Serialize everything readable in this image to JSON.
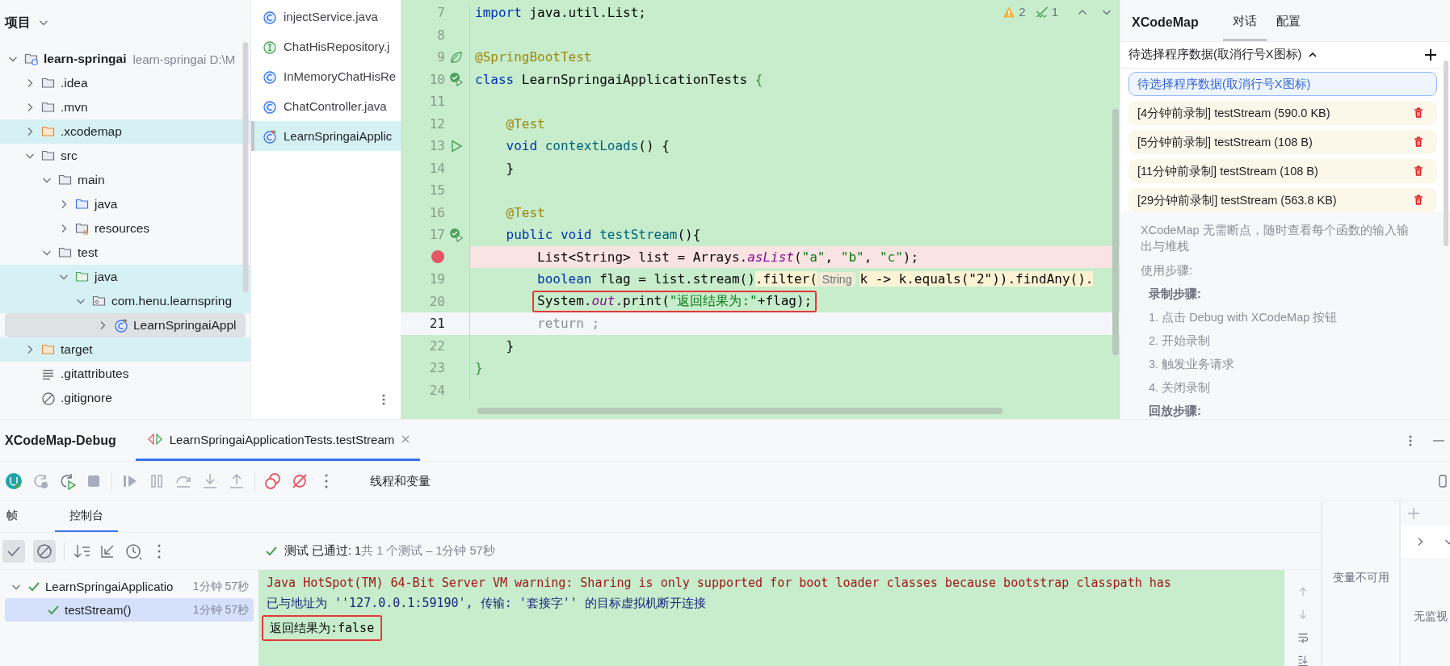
{
  "project": {
    "title": "项目",
    "tree": [
      {
        "name": "learn-springai",
        "detail": "learn-springai  D:\\M",
        "kind": "module",
        "expanded": true,
        "highlighted": false,
        "selected": false,
        "children": [
          {
            "name": ".idea",
            "kind": "folder",
            "expanded": false,
            "highlighted": false,
            "selected": false
          },
          {
            "name": ".mvn",
            "kind": "folder",
            "expanded": false,
            "highlighted": false,
            "selected": false
          },
          {
            "name": ".xcodemap",
            "kind": "excluded",
            "expanded": false,
            "highlighted": true,
            "selected": false
          },
          {
            "name": "src",
            "kind": "folder",
            "expanded": true,
            "highlighted": false,
            "selected": false,
            "children": [
              {
                "name": "main",
                "kind": "folder",
                "expanded": true,
                "highlighted": false,
                "selected": false,
                "children": [
                  {
                    "name": "java",
                    "kind": "source",
                    "expanded": false,
                    "highlighted": false,
                    "selected": false
                  },
                  {
                    "name": "resources",
                    "kind": "resources",
                    "expanded": false,
                    "highlighted": false,
                    "selected": false
                  }
                ]
              },
              {
                "name": "test",
                "kind": "folder",
                "expanded": true,
                "highlighted": false,
                "selected": false,
                "children": [
                  {
                    "name": "java",
                    "kind": "test-source",
                    "expanded": true,
                    "highlighted": true,
                    "selected": false,
                    "children": [
                      {
                        "name": "com.henu.learnspring",
                        "kind": "package",
                        "expanded": true,
                        "highlighted": true,
                        "selected": false,
                        "children": [
                          {
                            "name": "LearnSpringaiAppl",
                            "kind": "test-class",
                            "expanded": false,
                            "highlighted": false,
                            "selected": true
                          }
                        ]
                      }
                    ]
                  }
                ]
              }
            ]
          },
          {
            "name": "target",
            "kind": "excluded",
            "expanded": false,
            "highlighted": true,
            "selected": false
          },
          {
            "name": ".gitattributes",
            "kind": "text",
            "highlighted": false,
            "selected": false
          },
          {
            "name": ".gitignore",
            "kind": "ignore",
            "highlighted": false,
            "selected": false
          }
        ]
      }
    ]
  },
  "files": [
    {
      "name": "injectService.java",
      "kind": "class",
      "selected": false
    },
    {
      "name": "ChatHisRepository.j",
      "kind": "interface",
      "selected": false
    },
    {
      "name": "InMemoryChatHisRe",
      "kind": "class",
      "selected": false
    },
    {
      "name": "ChatController.java",
      "kind": "class",
      "selected": false
    },
    {
      "name": "LearnSpringaiApplic",
      "kind": "test-class",
      "selected": true
    }
  ],
  "editor": {
    "inspections": {
      "warnings": "2",
      "typos": "1"
    },
    "lines": [
      {
        "number": "7",
        "kind": "plain",
        "current": false,
        "boxed": false,
        "segments": [
          {
            "kind": "keyword",
            "text": "import"
          },
          {
            "kind": "plain",
            "text": " java.util.List;"
          }
        ]
      },
      {
        "number": "8",
        "kind": "plain",
        "current": false,
        "boxed": false
      },
      {
        "number": "9",
        "kind": "spring",
        "current": false,
        "boxed": false,
        "segments": [
          {
            "kind": "annotation",
            "text": "@SpringBootTest"
          }
        ]
      },
      {
        "number": "10",
        "kind": "run-test",
        "current": false,
        "boxed": false,
        "segments": [
          {
            "kind": "keyword",
            "text": "class"
          },
          {
            "kind": "plain",
            "text": " LearnSpringaiApplicationTests "
          },
          {
            "kind": "brace",
            "text": "{"
          }
        ]
      },
      {
        "number": "11",
        "kind": "plain",
        "current": false,
        "boxed": false
      },
      {
        "number": "12",
        "kind": "plain",
        "current": false,
        "boxed": false,
        "segments": [
          {
            "kind": "annotation",
            "text": "    @Test"
          }
        ]
      },
      {
        "number": "13",
        "kind": "run",
        "current": false,
        "boxed": false,
        "segments": [
          {
            "kind": "keyword",
            "text": "    void"
          },
          {
            "kind": "method",
            "text": " contextLoads"
          },
          {
            "kind": "plain",
            "text": "() {"
          }
        ]
      },
      {
        "number": "14",
        "kind": "plain",
        "current": false,
        "boxed": false,
        "segments": [
          {
            "kind": "plain",
            "text": "    }"
          }
        ]
      },
      {
        "number": "15",
        "kind": "plain",
        "current": false,
        "boxed": false
      },
      {
        "number": "16",
        "kind": "plain",
        "current": false,
        "boxed": false,
        "segments": [
          {
            "kind": "annotation",
            "text": "    @Test"
          }
        ]
      },
      {
        "number": "17",
        "kind": "run-test",
        "current": false,
        "boxed": false,
        "segments": [
          {
            "kind": "keyword",
            "text": "    public void"
          },
          {
            "kind": "method",
            "text": " testStream"
          },
          {
            "kind": "plain",
            "text": "(){"
          }
        ]
      },
      {
        "kind": "breakpoint",
        "current": false,
        "boxed": false,
        "segments": [
          {
            "kind": "plain",
            "text": "        List<String> list = Arrays."
          },
          {
            "kind": "static",
            "text": "asList"
          },
          {
            "kind": "plain",
            "text": "("
          },
          {
            "kind": "string",
            "text": "\"a\""
          },
          {
            "kind": "plain",
            "text": ", "
          },
          {
            "kind": "string",
            "text": "\"b\""
          },
          {
            "kind": "plain",
            "text": ", "
          },
          {
            "kind": "string",
            "text": "\"c\""
          },
          {
            "kind": "plain",
            "text": ");"
          }
        ]
      },
      {
        "number": "19",
        "kind": "plain",
        "current": false,
        "boxed": false,
        "segments": [
          {
            "kind": "keyword",
            "text": "        boolean"
          },
          {
            "kind": "plain",
            "text": " flag = list.stream()"
          },
          {
            "kind": "chain",
            "text": ".filter("
          },
          {
            "kind": "hint",
            "text": "String"
          },
          {
            "kind": "chain",
            "text": "k -> k.equals(\"2\")).findAny()."
          }
        ]
      },
      {
        "number": "20",
        "kind": "plain",
        "current": false,
        "boxed": true,
        "segments": [
          {
            "kind": "plain",
            "text": "        System."
          },
          {
            "kind": "static",
            "text": "out"
          },
          {
            "kind": "plain",
            "text": ".print("
          },
          {
            "kind": "string",
            "text": "\"返回结果为:\""
          },
          {
            "kind": "plain",
            "text": "+flag);"
          }
        ]
      },
      {
        "number": "21",
        "kind": "plain",
        "current": true,
        "boxed": false,
        "segments": [
          {
            "kind": "dim",
            "text": "        return ;"
          }
        ]
      },
      {
        "number": "22",
        "kind": "plain",
        "current": false,
        "boxed": false,
        "segments": [
          {
            "kind": "plain",
            "text": "    }"
          }
        ]
      },
      {
        "number": "23",
        "kind": "plain",
        "current": false,
        "boxed": false,
        "segments": [
          {
            "kind": "brace",
            "text": "}"
          }
        ]
      },
      {
        "number": "24",
        "kind": "plain",
        "current": false,
        "boxed": false
      }
    ]
  },
  "xcodemap": {
    "title": "XCodeMap",
    "tabs": [
      {
        "label": "对话",
        "selected": true
      },
      {
        "label": "配置",
        "selected": false
      }
    ],
    "picker": "待选择程序数据(取消行号X图标)",
    "records": [
      {
        "kind": "placeholder",
        "text": "待选择程序数据(取消行号X图标)",
        "selected": true
      },
      {
        "kind": "recording",
        "text": "[4分钟前录制] testStream (590.0 KB)",
        "selected": false
      },
      {
        "kind": "recording",
        "text": "[5分钟前录制] testStream (108 B)",
        "selected": false
      },
      {
        "kind": "recording",
        "text": "[11分钟前录制] testStream (108 B)",
        "selected": false
      },
      {
        "kind": "recording",
        "text": "[29分钟前录制] testStream (563.8 KB)",
        "selected": false
      }
    ],
    "help": [
      {
        "kind": "paragraph",
        "text": "XCodeMap 无需断点，随时查看每个函数的输入输出与堆栈"
      },
      {
        "kind": "paragraph",
        "text": "使用步骤:"
      },
      {
        "kind": "heading",
        "text": "录制步骤:"
      },
      {
        "kind": "step",
        "text": "1. 点击 Debug with XCodeMap 按钮"
      },
      {
        "kind": "step",
        "text": "2. 开始录制"
      },
      {
        "kind": "step",
        "text": "3. 触发业务请求"
      },
      {
        "kind": "step",
        "text": "4. 关闭录制"
      },
      {
        "kind": "heading",
        "text": "回放步骤:"
      }
    ]
  },
  "debug": {
    "title": "XCodeMap-Debug",
    "tabs": [
      {
        "label": "LearnSpringaiApplicationTests.testStream",
        "selected": true
      }
    ],
    "threads_label": "线程和变量",
    "subtabs": [
      {
        "label": "帧",
        "selected": false
      },
      {
        "label": "控制台",
        "selected": true
      }
    ],
    "filters": [
      {
        "kind": "passed",
        "on": true
      },
      {
        "kind": "ignored",
        "on": true
      }
    ],
    "status": {
      "summary": "测试 已通过: 1",
      "detail": "共 1 个测试 – 1分钟 57秒"
    },
    "tests": [
      {
        "name": "LearnSpringaiApplicatio",
        "time": "1分钟 57秒",
        "passed": true,
        "expanded": true,
        "selected": false,
        "children": [
          {
            "name": "testStream()",
            "time": "1分钟 57秒",
            "passed": true,
            "selected": true
          }
        ]
      }
    ],
    "console": [
      {
        "kind": "warning",
        "text": "Java HotSpot(TM) 64-Bit Server VM warning: Sharing is only supported for boot loader classes because bootstrap classpath has",
        "boxed": false
      },
      {
        "kind": "info",
        "text": "已与地址为 ''127.0.0.1:59190', 传输: '套接字'' 的目标虚拟机断开连接",
        "boxed": false
      },
      {
        "kind": "output",
        "text": "返回结果为:false",
        "boxed": true
      }
    ],
    "variables": "变量不可用",
    "watches": "无监视"
  }
}
